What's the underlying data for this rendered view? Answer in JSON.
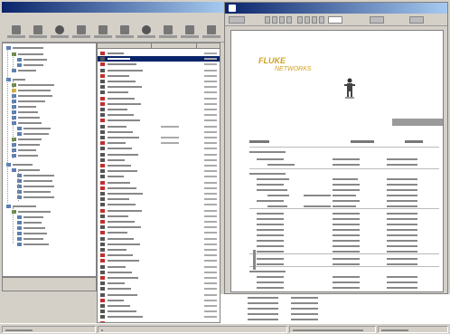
{
  "main_window": {
    "title": "",
    "menu": [
      "",
      "",
      "",
      "",
      "",
      "",
      "",
      ""
    ]
  },
  "toolbar": {
    "buttons": [
      "",
      "",
      "",
      "",
      "",
      "",
      "",
      "",
      "",
      ""
    ]
  },
  "tree": {
    "items": [
      "",
      "",
      "",
      "",
      "",
      "",
      "",
      "",
      "",
      "",
      "",
      "",
      "",
      "",
      "",
      "",
      "",
      "",
      "",
      "",
      "",
      "",
      "",
      "",
      "",
      "",
      "",
      "",
      "",
      "",
      "",
      "",
      "",
      "",
      ""
    ],
    "status": ""
  },
  "list": {
    "headers": [
      "",
      "",
      ""
    ]
  },
  "report_window": {
    "title": "",
    "toolbar_page": ""
  },
  "report": {
    "logo_line1": "FLUKE",
    "logo_line2": "NETWORKS",
    "header_bar": "",
    "columns": [
      "",
      "",
      ""
    ]
  },
  "status": {
    "panes": [
      "",
      "",
      "",
      ""
    ]
  },
  "colors": {
    "title_active": "#0a246a",
    "title_gradient_end": "#a6caf0",
    "chrome": "#d4d0c8",
    "logo": "#d0a020",
    "alarm": "#c03030"
  }
}
